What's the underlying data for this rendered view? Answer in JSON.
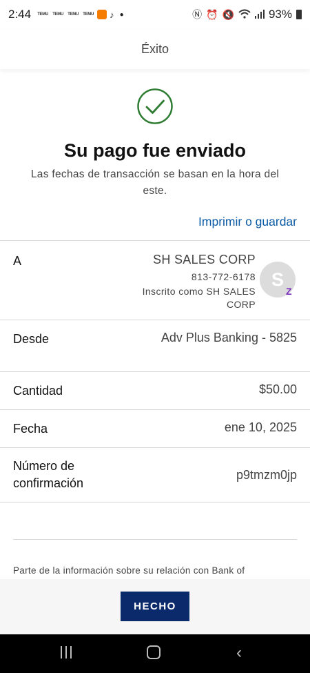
{
  "status_bar": {
    "time": "2:44",
    "temu_badge": "TEMU",
    "battery": "93%"
  },
  "header": {
    "title": "Éxito"
  },
  "success": {
    "title": "Su pago fue enviado",
    "subtitle": "Las fechas de transacción se basan en la hora del este.",
    "print_link": "Imprimir o guardar"
  },
  "details": {
    "to": {
      "label": "A",
      "name": "SH SALES CORP",
      "phone": "813-772-6178",
      "registered_line1": "Inscrito como SH SALES",
      "registered_line2": "CORP",
      "avatar_letter": "S",
      "badge": "Z"
    },
    "from": {
      "label": "Desde",
      "value": "Adv Plus Banking - 5825"
    },
    "amount": {
      "label": "Cantidad",
      "value": "$50.00"
    },
    "date": {
      "label": "Fecha",
      "value": "ene 10, 2025"
    },
    "confirmation": {
      "label_line1": "Número de",
      "label_line2": "confirmación",
      "value": "p9tmzm0jp"
    }
  },
  "footer": {
    "note": "Parte de la información sobre su relación con Bank of",
    "done_button": "HECHO"
  },
  "colors": {
    "success_green": "#2e7d32",
    "link_blue": "#0a5aa6",
    "button_navy": "#0b2a6b",
    "zelle_purple": "#7a2fbf"
  },
  "icons": [
    "check-circle-icon",
    "nfc-icon",
    "alarm-icon",
    "mute-icon",
    "wifi-icon",
    "signal-icon",
    "battery-icon",
    "recent-apps-icon",
    "home-icon",
    "back-icon"
  ]
}
